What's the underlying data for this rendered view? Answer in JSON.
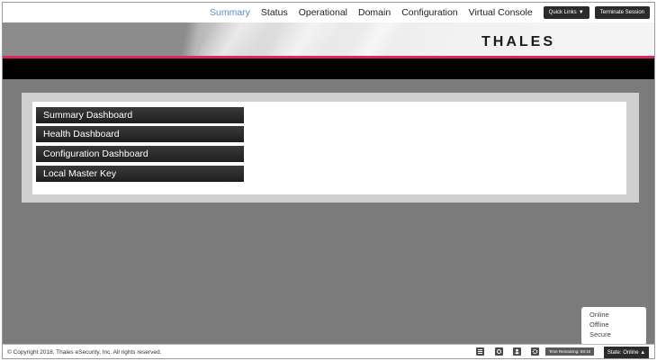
{
  "nav": {
    "items": [
      {
        "label": "Summary",
        "active": true
      },
      {
        "label": "Status",
        "active": false
      },
      {
        "label": "Operational",
        "active": false
      },
      {
        "label": "Domain",
        "active": false
      },
      {
        "label": "Configuration",
        "active": false
      },
      {
        "label": "Virtual Console",
        "active": false
      }
    ],
    "quick_links_label": "Quick Links",
    "terminate_label": "Terminate Session"
  },
  "banner": {
    "logo_text": "THALES"
  },
  "menu": {
    "items": [
      {
        "label": "Summary Dashboard"
      },
      {
        "label": "Health Dashboard"
      },
      {
        "label": "Configuration Dashboard"
      },
      {
        "label": "Local Master Key"
      }
    ]
  },
  "state_menu": {
    "options": [
      "Online",
      "Offline",
      "Secure"
    ]
  },
  "footer": {
    "copyright": "© Copyright 2018, Thales eSecurity, Inc. All rights reserved.",
    "time_remaining": "Time Remaining: 59:15",
    "state_button_label": "State: Online"
  },
  "colors": {
    "accent_active": "#5b8ec9",
    "brand_pink": "#e0265f",
    "background_gray": "#7b7b7b"
  },
  "icons": {
    "footer": [
      "list-icon",
      "disk-icon",
      "user-icon",
      "settings-icon"
    ]
  }
}
